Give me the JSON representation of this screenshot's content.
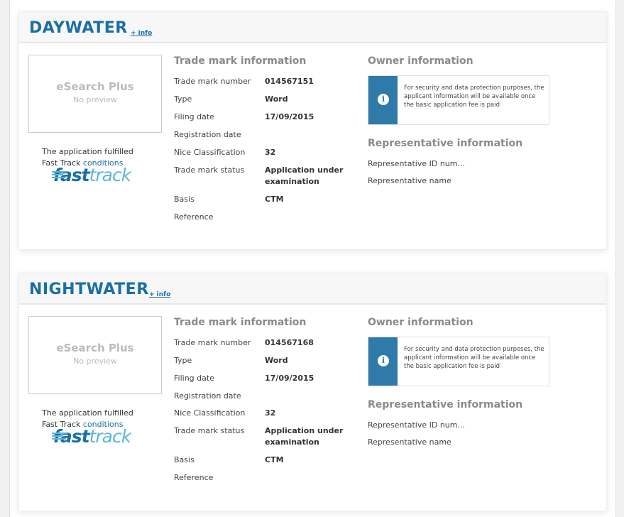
{
  "labels": {
    "info_link": "+ info",
    "preview_title": "eSearch Plus",
    "preview_sub": "No preview",
    "fast_track_line1": "The application fulfilled",
    "fast_track_line2": "Fast Track",
    "fast_track_link": "conditions",
    "logo_fast": "fast",
    "logo_track": "track",
    "tm_section": "Trade mark information",
    "owner_section": "Owner information",
    "owner_notice": "For security and data protection purposes, the applicant information will be available once the basic application fee is paid",
    "rep_section": "Representative information",
    "rep_id": "Representative ID num...",
    "rep_name": "Representative name",
    "field_number": "Trade mark number",
    "field_type": "Type",
    "field_filing": "Filing date",
    "field_registration": "Registration date",
    "field_nice": "Nice Classification",
    "field_status": "Trade mark status",
    "field_basis": "Basis",
    "field_reference": "Reference"
  },
  "colors": {
    "brand_blue": "#1a6fa3",
    "notice_blue": "#2e7aa8",
    "fast_track_light": "#5cb6d9"
  },
  "icons": {
    "notice": "info-icon"
  },
  "records": [
    {
      "name": "DAYWATER",
      "number": "014567151",
      "type": "Word",
      "filing_date": "17/09/2015",
      "registration_date": "",
      "nice": "32",
      "status": "Application under examination",
      "basis": "CTM",
      "reference": ""
    },
    {
      "name": "NIGHTWATER",
      "number": "014567168",
      "type": "Word",
      "filing_date": "17/09/2015",
      "registration_date": "",
      "nice": "32",
      "status": "Application under examination",
      "basis": "CTM",
      "reference": ""
    }
  ]
}
